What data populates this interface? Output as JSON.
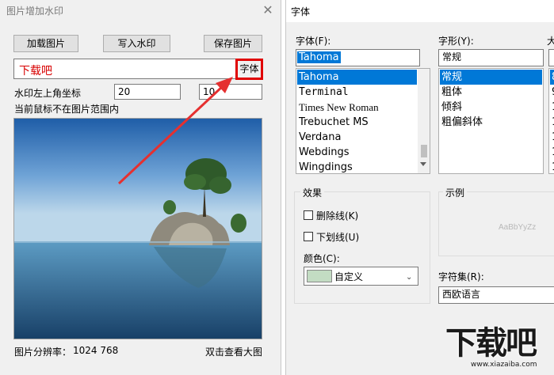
{
  "left_window": {
    "title": "图片增加水印",
    "close": "✕",
    "buttons": {
      "load": "加载图片",
      "write": "写入水印",
      "save": "保存图片"
    },
    "watermark_text": "下载吧",
    "font_button": "字体",
    "coord_label": "水印左上角坐标",
    "x_value": "20",
    "y_value": "10",
    "mouse_status": "当前鼠标不在图片范围内",
    "resolution_label": "图片分辨率：",
    "resolution_value": "1024 768",
    "view_large": "双击查看大图"
  },
  "font_dialog": {
    "title": "字体",
    "font_label": "字体(F):",
    "font_value": "Tahoma",
    "font_list": [
      "Tahoma",
      "Terminal",
      "Times New Roman",
      "Trebuchet MS",
      "Verdana",
      "Webdings",
      "Wingdings"
    ],
    "style_label": "字形(Y):",
    "style_value": "常规",
    "style_list": [
      "常规",
      "粗体",
      "倾斜",
      "粗偏斜体"
    ],
    "size_label": "大",
    "size_list": [
      "8",
      "9",
      "1",
      "1",
      "1",
      "1",
      "1"
    ],
    "effects_label": "效果",
    "strikeout_label": "删除线(K)",
    "underline_label": "下划线(U)",
    "color_label": "颜色(C):",
    "color_value": "自定义",
    "color_swatch": "#c3dcc3",
    "sample_label": "示例",
    "sample_text": "AaBbYyZz",
    "charset_label": "字符集(R):",
    "charset_value": "西欧语言"
  },
  "watermark": {
    "brand": "下载吧",
    "url": "www.xiazaiba.com"
  },
  "colors": {
    "accent": "#e00000",
    "selection": "#0078d7"
  }
}
